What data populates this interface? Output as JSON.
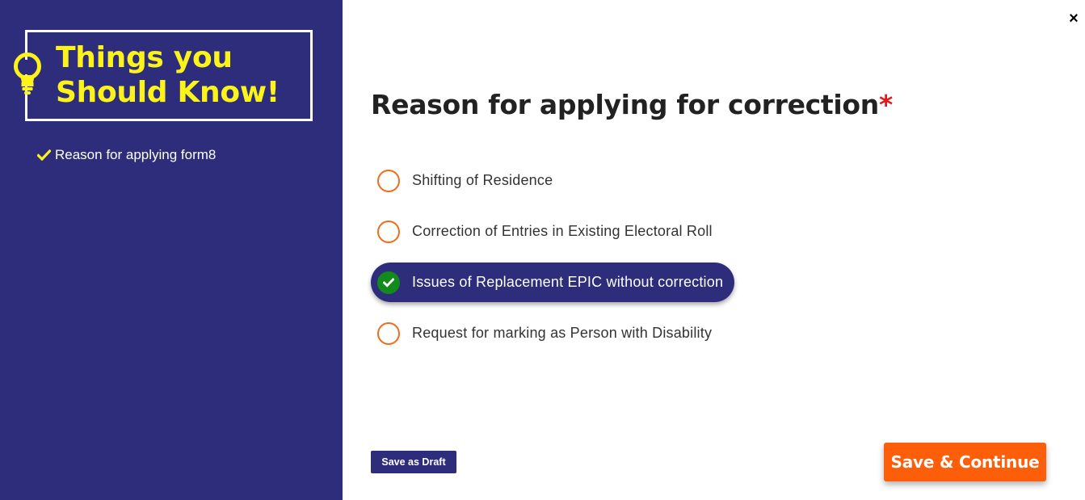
{
  "sidebar": {
    "title_line1": "Things you",
    "title_line2": "Should Know!",
    "tips": [
      {
        "label": "Reason for applying form8"
      }
    ]
  },
  "main": {
    "heading": "Reason for applying for correction",
    "required_mark": "*",
    "close_label": "×",
    "options": [
      {
        "label": "Shifting of Residence",
        "selected": false
      },
      {
        "label": "Correction of Entries in Existing Electoral Roll",
        "selected": false
      },
      {
        "label": "Issues of Replacement EPIC without correction",
        "selected": true
      },
      {
        "label": "Request for marking as Person with Disability",
        "selected": false
      }
    ],
    "save_draft_label": "Save as Draft",
    "continue_label": "Save & Continue"
  },
  "colors": {
    "sidebar_bg": "#2e2d7b",
    "accent_yellow": "#fbf319",
    "radio_orange": "#ef6c1b",
    "selected_check": "#138b1c",
    "primary_button": "#fc5e0a",
    "required": "#e3161b"
  },
  "icons": {
    "bulb": "lightbulb-icon",
    "tip": "checkmark-icon",
    "close": "close-icon",
    "selected": "check-circle-icon"
  }
}
